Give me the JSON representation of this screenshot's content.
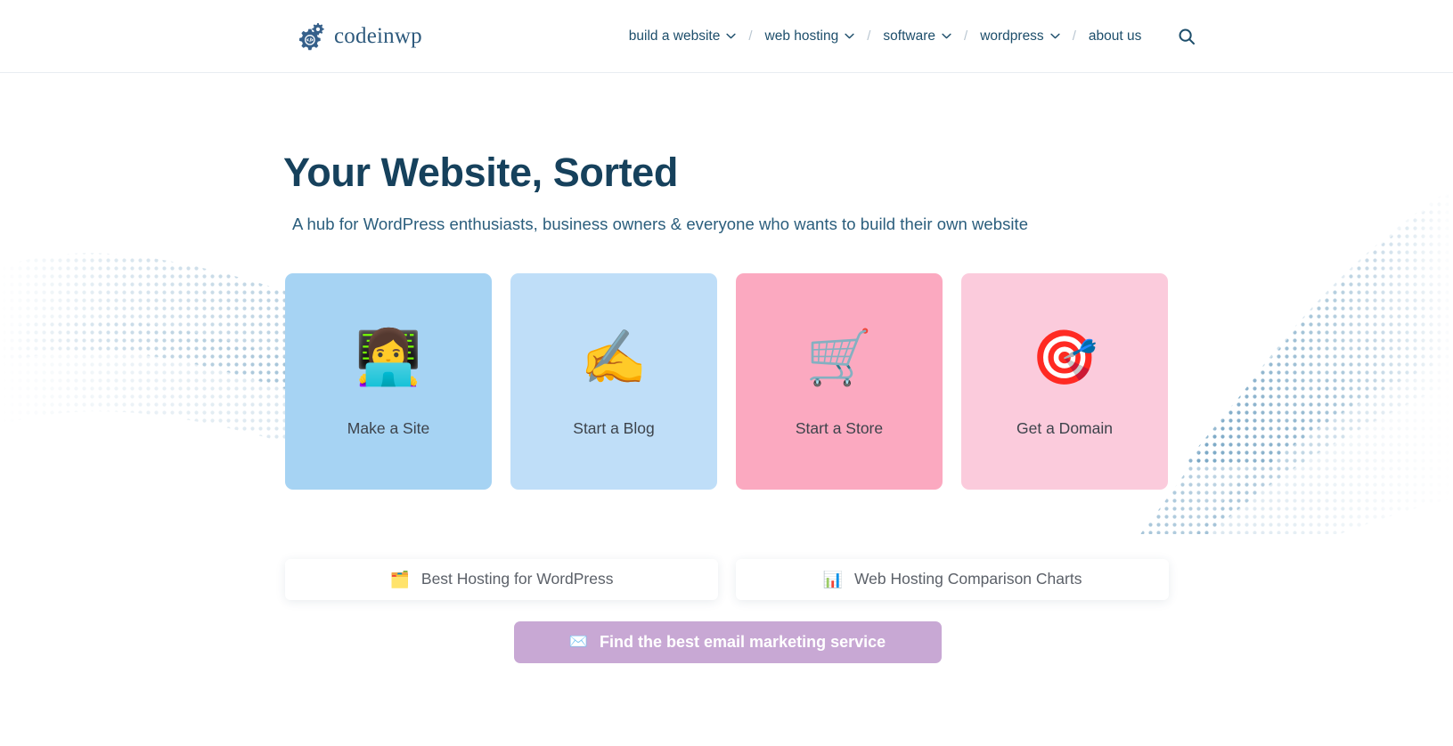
{
  "header": {
    "brand": {
      "name": "codeinwp",
      "logo_icon": "gear-code-logo"
    },
    "nav": [
      {
        "label": "build a website",
        "has_dropdown": true
      },
      {
        "label": "web hosting",
        "has_dropdown": true
      },
      {
        "label": "software",
        "has_dropdown": true
      },
      {
        "label": "wordpress",
        "has_dropdown": true
      },
      {
        "label": "about us",
        "has_dropdown": false
      }
    ],
    "separator": "/",
    "search_icon": "search-icon"
  },
  "hero": {
    "title": "Your Website, Sorted",
    "subtitle": "A hub for WordPress enthusiasts, business owners & everyone who wants to build their own website"
  },
  "cards": [
    {
      "label": "Make a Site",
      "emoji": "👩‍💻",
      "icon_name": "person-laptop-emoji",
      "bg": "#a6d3f3"
    },
    {
      "label": "Start a Blog",
      "emoji": "✍️",
      "icon_name": "writing-hand-emoji",
      "bg": "#bfdef8"
    },
    {
      "label": "Start a Store",
      "emoji": "🛒",
      "icon_name": "shopping-cart-emoji",
      "bg": "#fba9c0"
    },
    {
      "label": "Get a Domain",
      "emoji": "🎯",
      "icon_name": "bullseye-dart-emoji",
      "bg": "#fbcbdc"
    }
  ],
  "link_buttons": [
    {
      "label": "Best Hosting for WordPress",
      "emoji": "🗂️",
      "icon_name": "card-index-dividers-emoji"
    },
    {
      "label": "Web Hosting Comparison Charts",
      "emoji": "📊",
      "icon_name": "bar-chart-emoji"
    }
  ],
  "cta": {
    "label": "Find the best email marketing service",
    "emoji": "✉️",
    "icon_name": "envelope-emoji",
    "color": "#c8a8d4"
  },
  "theme": {
    "heading_color": "#16415c",
    "nav_color": "#1d4e6b",
    "body_bg": "#ffffff",
    "deco_dot_color": "#5b93b8"
  }
}
